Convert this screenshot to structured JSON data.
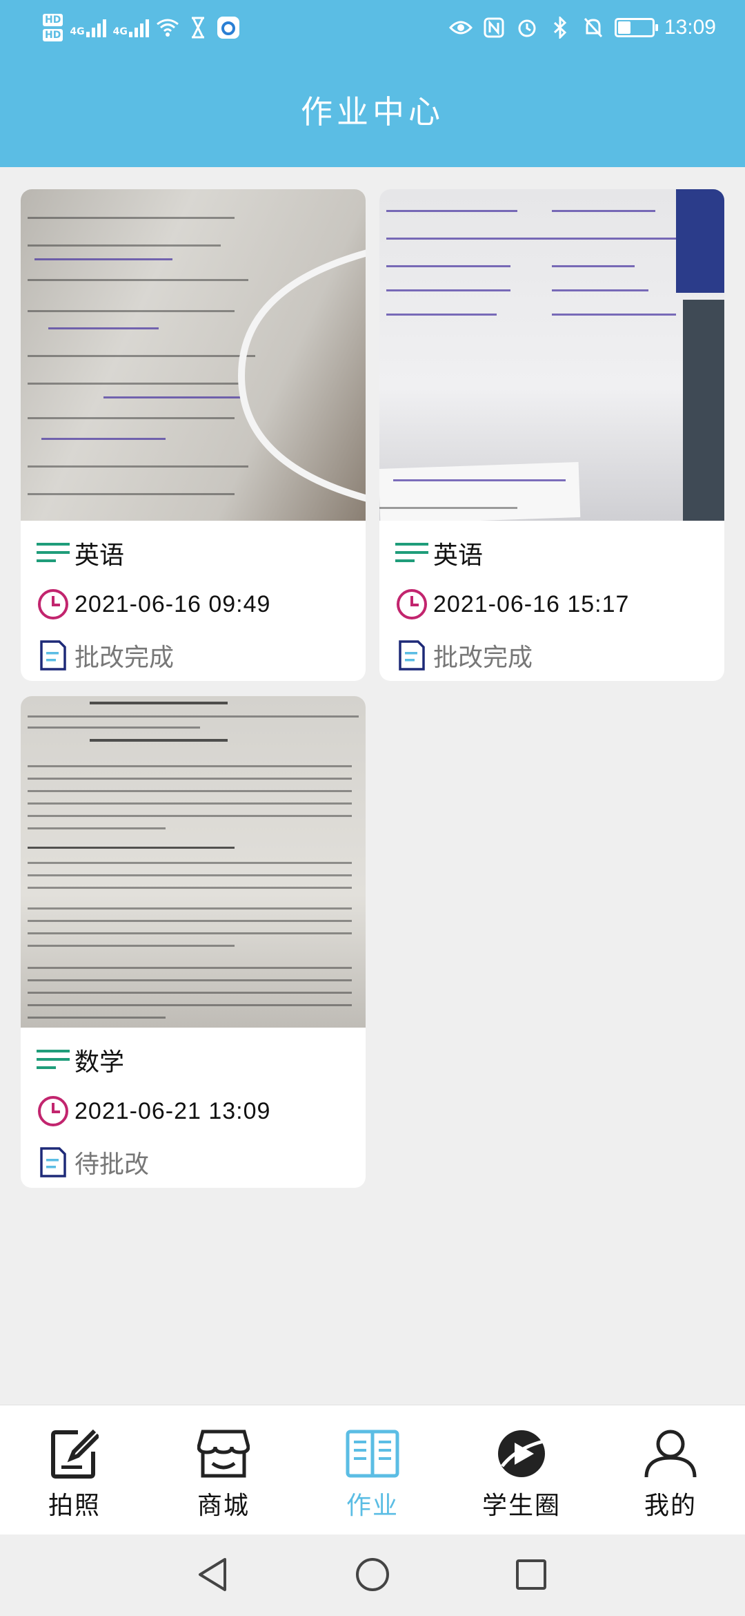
{
  "status_bar": {
    "hd1": "HD",
    "hd2": "HD",
    "net1": "4G",
    "net2": "4G",
    "time": "13:09"
  },
  "header": {
    "title": "作业中心"
  },
  "cards": [
    {
      "subject": "英语",
      "datetime": "2021-06-16  09:49",
      "status": "批改完成"
    },
    {
      "subject": "英语",
      "datetime": "2021-06-16  15:17",
      "status": "批改完成"
    },
    {
      "subject": "数学",
      "datetime": "2021-06-21  13:09",
      "status": "待批改"
    }
  ],
  "tabs": [
    {
      "label": "拍照",
      "icon": "edit-icon"
    },
    {
      "label": "商城",
      "icon": "store-icon"
    },
    {
      "label": "作业",
      "icon": "book-icon",
      "active": true
    },
    {
      "label": "学生圈",
      "icon": "play-circle-icon"
    },
    {
      "label": "我的",
      "icon": "user-icon"
    }
  ],
  "colors": {
    "brand": "#5bbde4",
    "subject_icon": "#1f9d7a",
    "clock_icon": "#c2256e",
    "doc_icon": "#1e2a78"
  }
}
